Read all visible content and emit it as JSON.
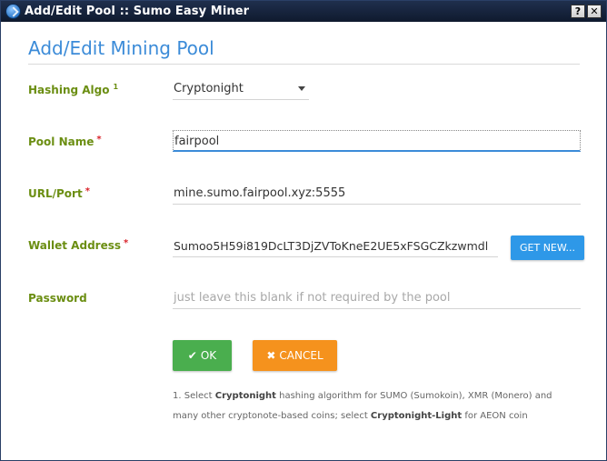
{
  "window": {
    "title": "Add/Edit Pool :: Sumo Easy Miner",
    "help_label": "?",
    "close_label": "✕"
  },
  "page": {
    "title": "Add/Edit Mining Pool"
  },
  "form": {
    "hashing_algo": {
      "label": "Hashing Algo",
      "footnote_marker": "1",
      "value": "Cryptonight",
      "options": [
        "Cryptonight"
      ]
    },
    "pool_name": {
      "label": "Pool Name",
      "required_marker": "*",
      "value": "fairpool"
    },
    "url_port": {
      "label": "URL/Port",
      "required_marker": "*",
      "value": "mine.sumo.fairpool.xyz:5555"
    },
    "wallet_address": {
      "label": "Wallet Address",
      "required_marker": "*",
      "value": "Sumoo5H59i819DcLT3DjZVToKneE2UE5xFSGCZkzwmdl",
      "get_new_label": "GET NEW..."
    },
    "password": {
      "label": "Password",
      "value": "",
      "placeholder": "just leave this blank if not required by the pool"
    }
  },
  "actions": {
    "ok_label": "OK",
    "cancel_label": "CANCEL"
  },
  "footnote": {
    "part1": "1. Select ",
    "algo1": "Cryptonight",
    "part2": " hashing algorithm for SUMO (Sumokoin), XMR (Monero) and many other cryptonote-based coins; select ",
    "algo2": "Cryptonight-Light",
    "part3": " for AEON coin"
  },
  "icons": {
    "app": "sumo-logo-icon",
    "ok": "check-icon",
    "cancel": "times-icon",
    "select": "caret-down-icon"
  },
  "colors": {
    "title_blue": "#3b8bd8",
    "label_green": "#6b8e12",
    "required_red": "#d9232a",
    "ok_green": "#4aae4e",
    "cancel_orange": "#f5921d",
    "get_new_blue": "#2e98e8"
  }
}
